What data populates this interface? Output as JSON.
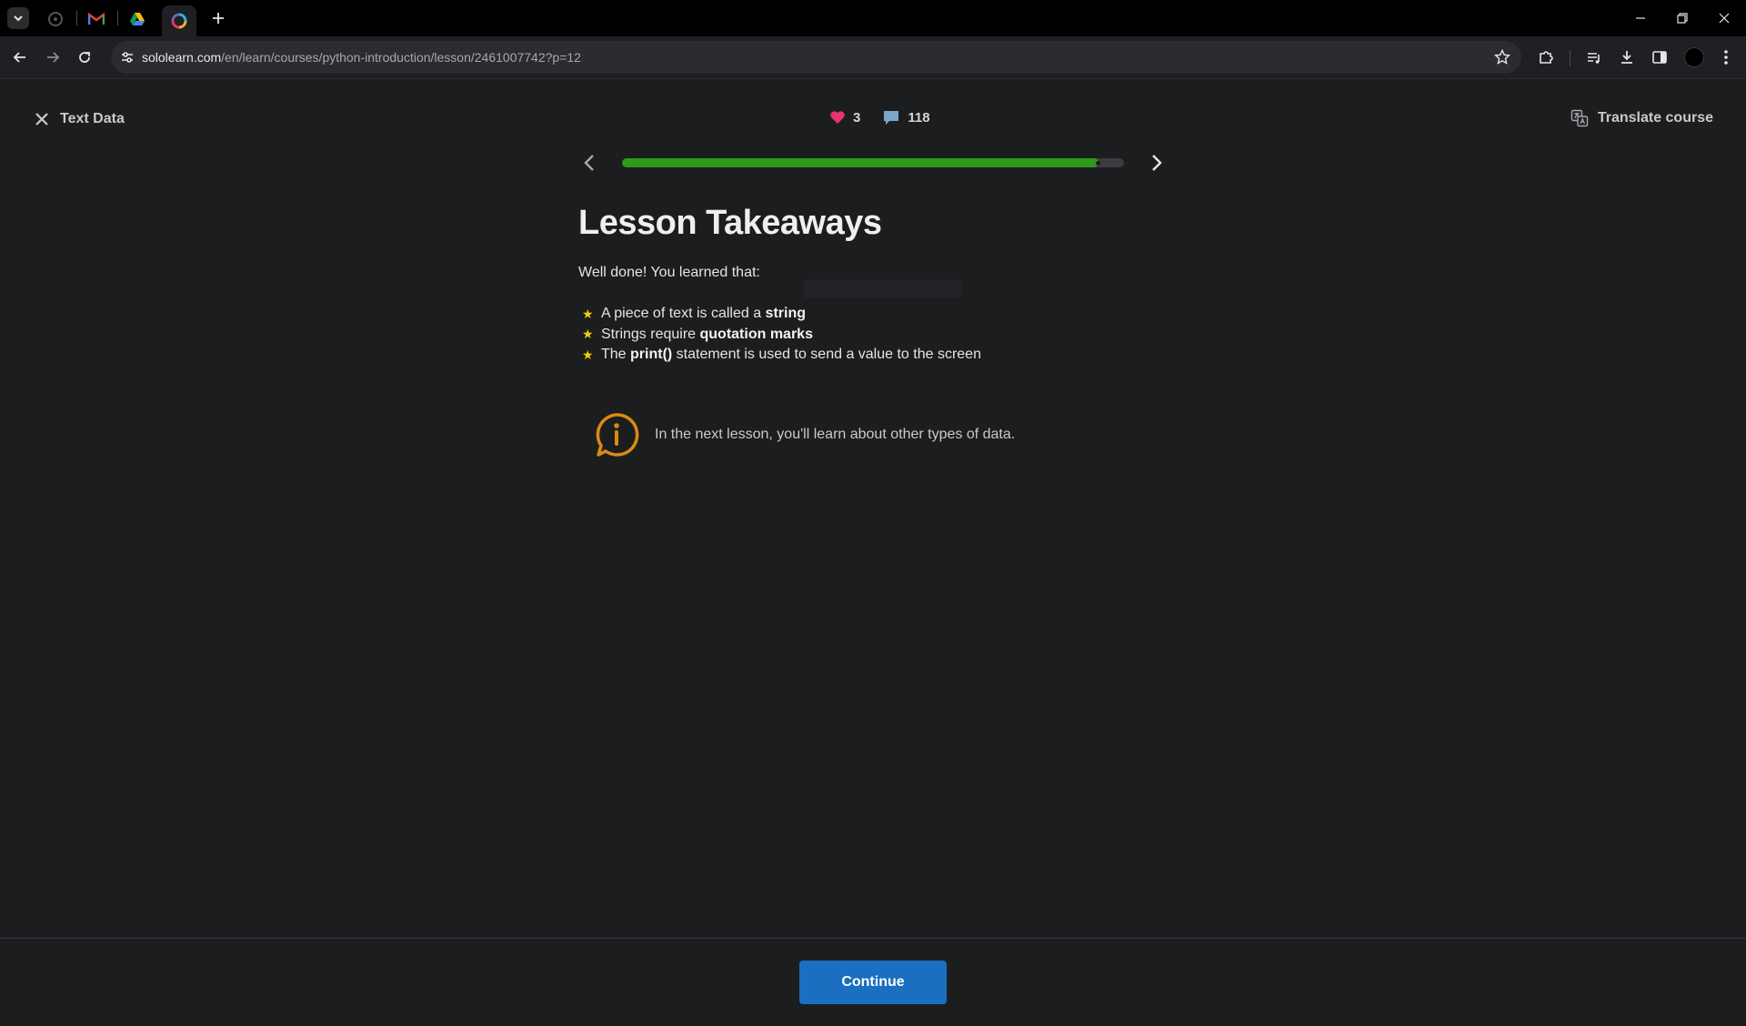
{
  "browser": {
    "url_host": "sololearn.com",
    "url_path": "/en/learn/courses/python-introduction/lesson/2461007742?p=12",
    "tabs": [
      {
        "icon": "github-icon"
      },
      {
        "icon": "gmail-icon"
      },
      {
        "icon": "drive-icon"
      },
      {
        "icon": "sololearn-icon",
        "active": true
      }
    ]
  },
  "lesson": {
    "close_label": "Text Data",
    "hearts": "3",
    "comments": "118",
    "translate_label": "Translate course",
    "progress": 0.95,
    "title": "Lesson Takeaways",
    "intro": "Well done! You learned that:",
    "takeaways": [
      {
        "pre": "A piece of text is called a ",
        "bold": "string",
        "post": ""
      },
      {
        "pre": "Strings require ",
        "bold": "quotation marks",
        "post": ""
      },
      {
        "pre": "The ",
        "bold": "print()",
        "post": " statement is used to send a value to the screen"
      }
    ],
    "info_text": "In the next lesson, you'll learn about other types of data.",
    "continue_label": "Continue"
  },
  "colors": {
    "accent_green": "#2e9a1b",
    "button_blue": "#1a6fc0",
    "star_yellow": "#f5d000",
    "heart_pink": "#e8336d",
    "info_orange": "#d98a14"
  }
}
